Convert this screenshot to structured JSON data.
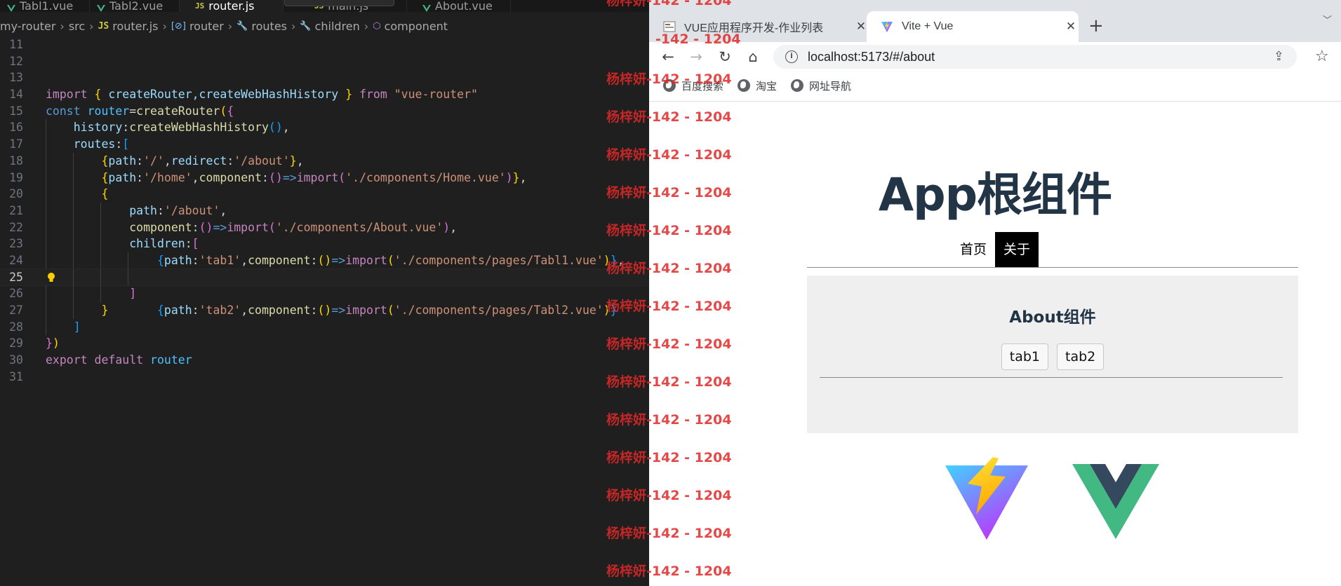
{
  "editor": {
    "tabs": [
      {
        "label": "Tabl1.vue",
        "kind": "vue",
        "active": false
      },
      {
        "label": "Tabl2.vue",
        "kind": "vue",
        "active": false
      },
      {
        "label": "router.js",
        "kind": "js",
        "active": true
      },
      {
        "label": "main.js",
        "kind": "js",
        "active": false
      },
      {
        "label": "About.vue",
        "kind": "vue",
        "active": false
      }
    ],
    "js_badge": "JS",
    "breadcrumb": {
      "project": "my-router",
      "folder": "src",
      "file": "router.js",
      "symbol_router": "router",
      "symbol_routes": "routes",
      "symbol_children": "children",
      "symbol_component": "component"
    },
    "line_numbers": [
      "11",
      "12",
      "13",
      "14",
      "15",
      "16",
      "17",
      "18",
      "19",
      "20",
      "21",
      "22",
      "23",
      "24",
      "25",
      "26",
      "27",
      "28",
      "29",
      "30",
      "31"
    ],
    "current_line": "25",
    "code": {
      "l14": {
        "import": "import",
        "names": "createRouter,createWebHashHistory",
        "from": "from",
        "module": "\"vue-router\""
      },
      "l15": {
        "const": "const",
        "var": "router",
        "fn": "createRouter"
      },
      "l16": {
        "key": "history",
        "fn": "createWebHashHistory"
      },
      "l17": {
        "key": "routes"
      },
      "l18": {
        "k1": "path",
        "v1": "'/'",
        "k2": "redirect",
        "v2": "'/about'"
      },
      "l19": {
        "k1": "path",
        "v1": "'/home'",
        "k2": "component",
        "imp": "import",
        "v2": "'./components/Home.vue'"
      },
      "l21": {
        "k1": "path",
        "v1": "'/about'"
      },
      "l22": {
        "k1": "component",
        "imp": "import",
        "v1": "'./components/About.vue'"
      },
      "l23": {
        "k1": "children"
      },
      "l24": {
        "k1": "path",
        "v1": "'tab1'",
        "k2": "component",
        "imp": "import",
        "v2": "'./components/pages/Tabl1.vue'"
      },
      "l25": {
        "k1": "path",
        "v1": "'tab2'",
        "k2": "component",
        "imp": "import",
        "v2": "'./components/pages/Tabl2.vue'"
      },
      "l30": {
        "export": "export",
        "default": "default",
        "var": "router"
      }
    }
  },
  "watermark": {
    "name": "杨梓妍",
    "number": "-142 - 1204"
  },
  "browser": {
    "tabs": [
      {
        "title": "VUE应用程序开发-作业列表",
        "active": false,
        "close": "✕"
      },
      {
        "title": "Vite + Vue",
        "active": true,
        "close": "✕"
      }
    ],
    "new_tab": "+",
    "tab_menu": "﹀",
    "url": "localhost:5173/#/about",
    "bookmarks": [
      "百度搜索",
      "淘宝",
      "网址导航"
    ]
  },
  "page": {
    "app_title": "App根组件",
    "nav": [
      {
        "label": "首页",
        "active": false
      },
      {
        "label": "关于",
        "active": true
      }
    ],
    "about_title": "About组件",
    "subnav": [
      "tab1",
      "tab2"
    ]
  },
  "colors": {
    "editor_bg": "#1f1f1f",
    "watermark": "#e12828",
    "page_heading": "#213547",
    "vite_purple": "#bd34fe",
    "vite_yellow": "#ffd62e",
    "vue_green": "#42b883",
    "vue_dark": "#35495e"
  }
}
